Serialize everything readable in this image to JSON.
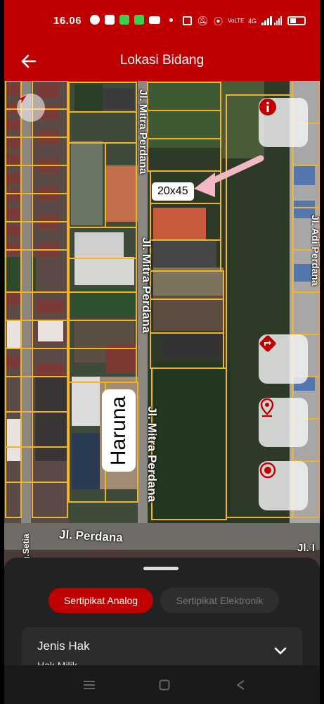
{
  "status_bar": {
    "time": "16.06",
    "network": "4G",
    "data_label": "VoLTE"
  },
  "app_bar": {
    "title": "Lokasi Bidang",
    "back_icon": "arrow-left-icon"
  },
  "map": {
    "road_labels": {
      "mitra_perdana_top": "Jl. Mitra Perdana",
      "mitra_perdana_mid": "Jl. Mitra Perdana",
      "mitra_perdana_bottom": "Jl. Mitra Perdana",
      "perdana": "Jl. Perdana",
      "perdana_right": "Jl. I",
      "gg_setia": "Gg.Setia",
      "right_road": "Jl. Adi Perdana"
    },
    "parcel_callout": "20x45",
    "handwritten_label": "Haruna",
    "controls": {
      "compass_icon": "compass-icon",
      "info_icon": "info-icon",
      "directions_icon": "directions-icon",
      "location_pin_icon": "location-pin-icon",
      "my_location_icon": "my-location-icon"
    },
    "colors": {
      "parcel_border": "#f2b324",
      "annotation_arrow": "#f4b8c4"
    }
  },
  "bottom_sheet": {
    "tabs": [
      {
        "label": "Sertipikat Analog",
        "active": true
      },
      {
        "label": "Sertipikat Elektronik",
        "active": false
      }
    ],
    "field": {
      "label": "Jenis Hak",
      "value": "Hak Milik"
    }
  },
  "theme": {
    "primary": "#c00000",
    "sheet_background": "#222222"
  }
}
